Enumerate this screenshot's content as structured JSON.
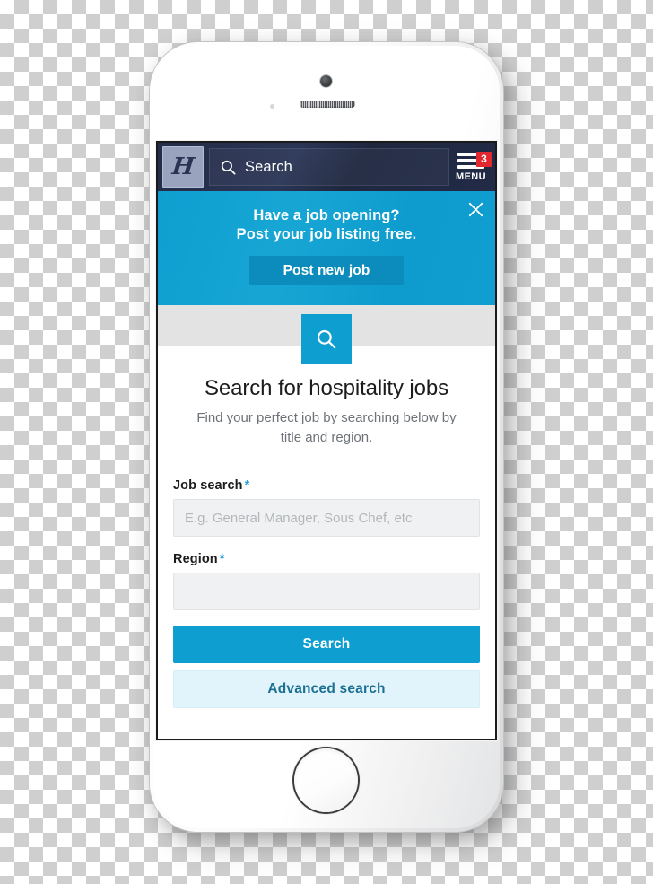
{
  "device": {
    "type": "smartphone-mockup",
    "color": "white",
    "hardware": {
      "camera": "front-camera",
      "earpiece": "earpiece-speaker",
      "sensor": "proximity-sensor",
      "home_button": "home-button"
    }
  },
  "navbar": {
    "logo_glyph": "H",
    "search_placeholder": "Search",
    "search_icon": "search-icon",
    "menu_label": "MENU",
    "menu_badge": "3",
    "menu_icon": "hamburger-menu-icon"
  },
  "promo": {
    "line1": "Have a job opening?",
    "line2": "Post your job listing free.",
    "cta_label": "Post new job",
    "close_icon": "close-icon"
  },
  "hero": {
    "icon": "search-icon",
    "title": "Search for hospitality jobs",
    "subtitle": "Find your perfect job by searching below by title and region."
  },
  "form": {
    "job_search": {
      "label": "Job search",
      "required_marker": "*",
      "placeholder": "E.g. General Manager, Sous Chef, etc",
      "value": ""
    },
    "region": {
      "label": "Region",
      "required_marker": "*",
      "placeholder": "",
      "value": ""
    },
    "search_button": "Search",
    "advanced_search_button": "Advanced search"
  },
  "colors": {
    "brand_blue": "#0e9fd0",
    "navbar_navy": "#232c48",
    "badge_red": "#e2282f",
    "cta_dark_blue": "#0b8cbc",
    "secondary_bg": "#e2f4fb",
    "secondary_text": "#1b6f93",
    "hero_band_gray": "#e3e3e3",
    "input_bg": "#f0f1f2"
  }
}
